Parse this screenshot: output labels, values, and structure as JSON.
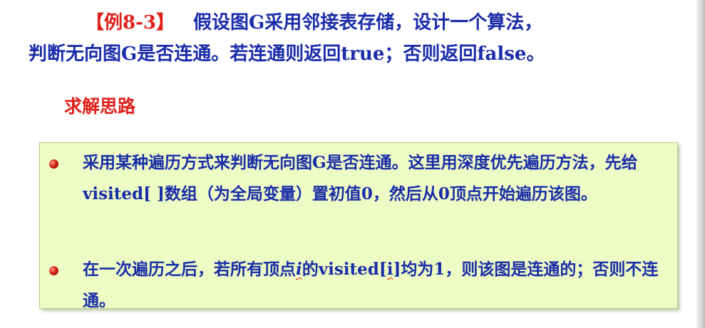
{
  "example": {
    "tag": "【例8-3】",
    "line1": "假设图G采用邻接表存储，设计一个算法，",
    "line2": "判断无向图G是否连通。若连通则返回true；否则返回false。"
  },
  "section_title": "求解思路",
  "bullets": [
    {
      "text": "采用某种遍历方式来判断无向图G是否连通。这里用深度优先遍历方法，先给visited[ ]数组（为全局变量）置初值0，然后从0顶点开始遍历该图。"
    },
    {
      "part1": "在一次遍历之后，若所有顶点",
      "var_i": "i",
      "part2": "的visited[",
      "index_i": "i",
      "part3": "]均为1，则该图是连通的；否则不连通。"
    }
  ],
  "colors": {
    "heading_red": "#e0201b",
    "text_blue": "#1a2ca8",
    "panel_bg": "#edfcc4"
  }
}
